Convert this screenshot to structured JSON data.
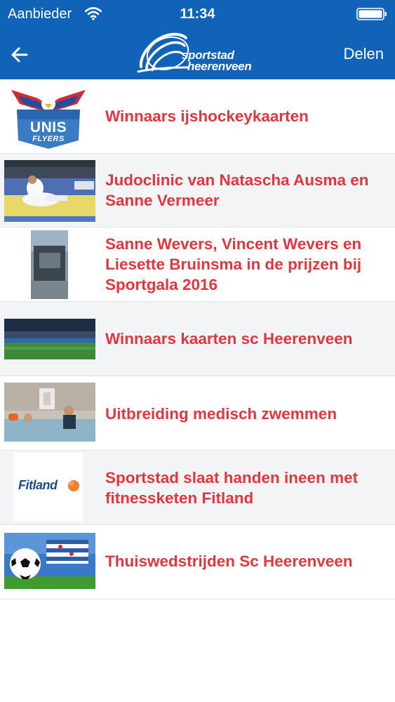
{
  "status_bar": {
    "carrier": "Aanbieder",
    "time": "11:34"
  },
  "nav": {
    "logo_line1": "sportstad",
    "logo_line2": "heerenveen",
    "share_label": "Delen"
  },
  "colors": {
    "header_bg": "#1163b7",
    "title_red": "#e2363f",
    "row_alt_bg": "#f2f4f6"
  },
  "news": {
    "items": [
      {
        "title": "Winnaars ijshockeykaarten",
        "thumb_text": "UNIS",
        "thumb_sub": "FLYERS"
      },
      {
        "title": "Judoclinic van Natascha Ausma en Sanne Vermeer"
      },
      {
        "title": "Sanne Wevers, Vincent Wevers en Liesette Bruinsma in de prijzen bij Sportgala 2016"
      },
      {
        "title": "Winnaars kaarten sc Heerenveen"
      },
      {
        "title": "Uitbreiding medisch zwemmen"
      },
      {
        "title": "Sportstad slaat handen ineen met fitnessketen Fitland",
        "thumb_text": "Fitland"
      },
      {
        "title": "Thuiswedstrijden Sc Heerenveen"
      }
    ]
  }
}
